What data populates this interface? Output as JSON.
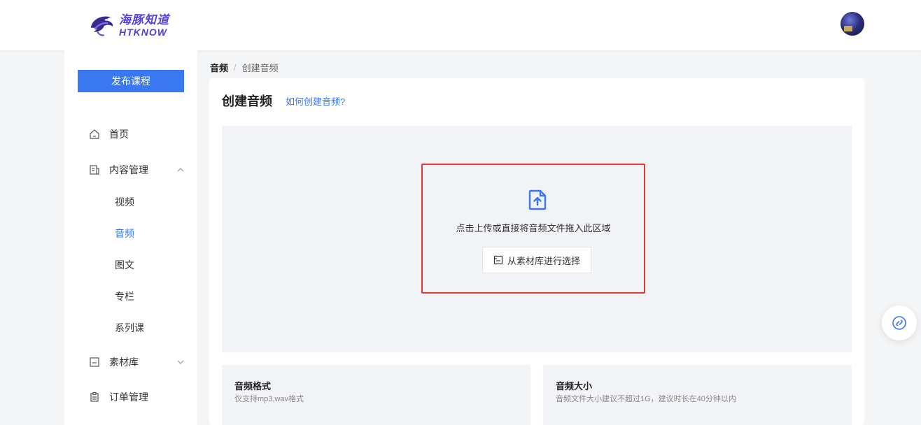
{
  "header": {
    "logo_cn": "海豚知道",
    "logo_en": "HTKNOW",
    "avatar_icon": "user-avatar"
  },
  "sidebar": {
    "publish_label": "发布课程",
    "items": [
      {
        "label": "首页",
        "icon": "home-icon"
      },
      {
        "label": "内容管理",
        "icon": "content-icon",
        "expanded": true
      },
      {
        "label": "素材库",
        "icon": "folder-icon",
        "expanded": false
      },
      {
        "label": "订单管理",
        "icon": "clipboard-icon"
      }
    ],
    "sub_items": [
      {
        "label": "视频"
      },
      {
        "label": "音频",
        "active": true
      },
      {
        "label": "图文"
      },
      {
        "label": "专栏"
      },
      {
        "label": "系列课"
      }
    ]
  },
  "breadcrumb": {
    "root": "音频",
    "sep": "/",
    "current": "创建音频"
  },
  "main": {
    "title": "创建音频",
    "help_link": "如何创建音频?",
    "upload": {
      "hint": "点击上传或直接将音频文件拖入此区域",
      "library_button": "从素材库进行选择"
    },
    "info": [
      {
        "title": "音频格式",
        "desc": "仅支持mp3,wav格式"
      },
      {
        "title": "音频大小",
        "desc": "音频文件大小建议不超过1G，建议时长在40分钟以内"
      }
    ]
  },
  "colors": {
    "accent": "#3a78f2",
    "highlight": "#e53935",
    "logo": "#5b3fd6"
  }
}
